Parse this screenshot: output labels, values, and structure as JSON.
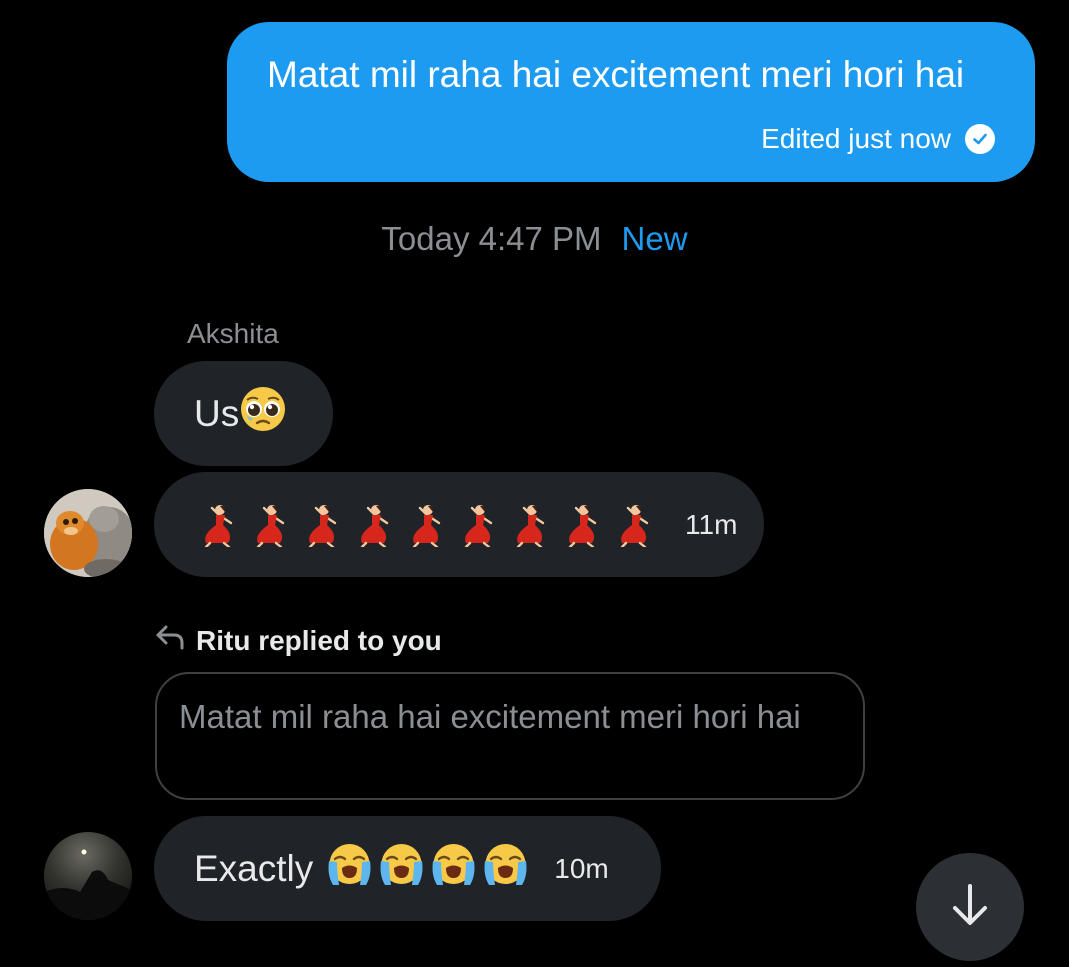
{
  "sent_message": {
    "text": "Matat mil raha hai excitement meri hori hai",
    "edited_label": "Edited just now",
    "bubble_color": "#1d9bf0"
  },
  "divider": {
    "timestamp": "Today 4:47 PM",
    "new_label": "New"
  },
  "messages": [
    {
      "sender": "Akshita",
      "text": "Us",
      "emoji": "pleading-face"
    },
    {
      "emoji": "woman-dancing",
      "emoji_count": 9,
      "time": "11m"
    },
    {
      "reply_label": "Ritu replied to you",
      "quoted_text": "Matat mil raha hai excitement meri hori hai",
      "text": "Exactly",
      "emoji": "loudly-crying-face",
      "emoji_count": 4,
      "time": "10m"
    }
  ],
  "icons": {
    "edited": "check-circle-icon",
    "reply": "reply-arrow-icon",
    "scroll": "arrow-down-icon"
  },
  "colors": {
    "background": "#000000",
    "received_bubble": "#202327",
    "muted_text": "#8b8f94",
    "accent": "#1d9bf0"
  }
}
